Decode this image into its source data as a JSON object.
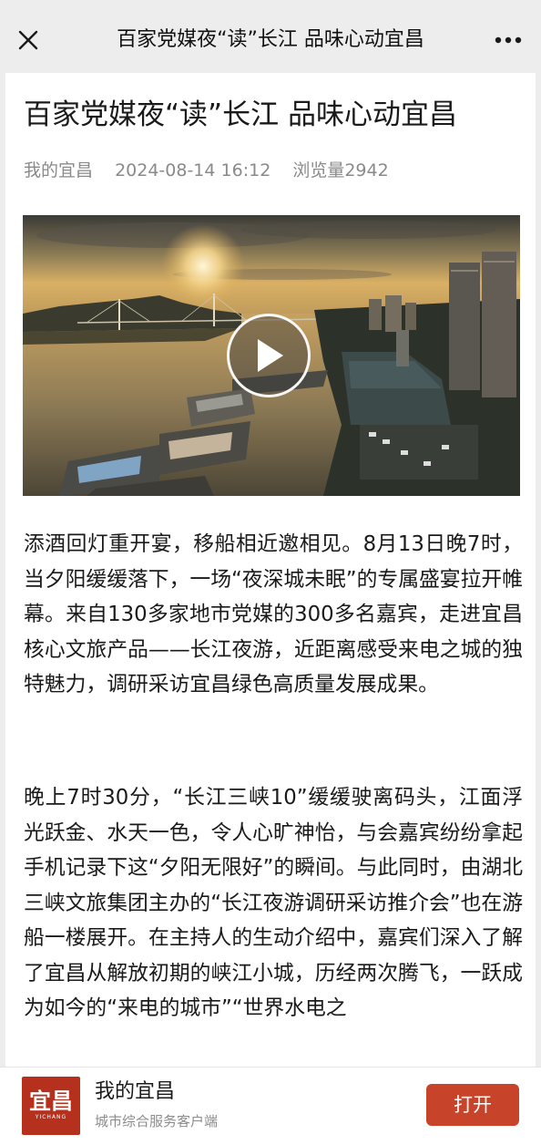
{
  "nav": {
    "title": "百家党媒夜“读”长江 品味心动宜昌",
    "close_icon": "close-icon",
    "more_icon": "more-icon"
  },
  "article": {
    "title": "百家党媒夜“读”长江 品味心动宜昌",
    "source": "我的宜昌",
    "datetime": "2024-08-14 16:12",
    "views": "浏览量2942",
    "video": {
      "play_icon": "play-icon"
    },
    "paragraphs": [
      "添酒回灯重开宴，移船相近邀相见。8月13日晚7时，当夕阳缓缓落下，一场“夜深城未眠”的专属盛宴拉开帷幕。来自130多家地市党媒的300多名嘉宾，走进宜昌核心文旅产品——长江夜游，近距离感受来电之城的独特魅力，调研采访宜昌绿色高质量发展成果。",
      "晚上7时30分，“长江三峡10”缓缓驶离码头，江面浮光跃金、水天一色，令人心旷神怡，与会嘉宾纷纷拿起手机记录下这“夕阳无限好”的瞬间。与此同时，由湖北三峡文旅集团主办的“长江夜游调研采访推介会”也在游船一楼展开。在主持人的生动介绍中，嘉宾们深入了解了宜昌从解放初期的峡江小城，历经两次腾飞，一跃成为如今的“来电的城市”“世界水电之"
    ]
  },
  "app_banner": {
    "logo_text": "宜昌",
    "logo_sub": "YICHANG",
    "name": "我的宜昌",
    "description": "城市综合服务客户端",
    "open_label": "打开"
  },
  "colors": {
    "nav_bg": "#ededed",
    "open_button": "#c7432a",
    "logo_bg": "#b5311e",
    "meta_text": "#8a8a8a"
  }
}
